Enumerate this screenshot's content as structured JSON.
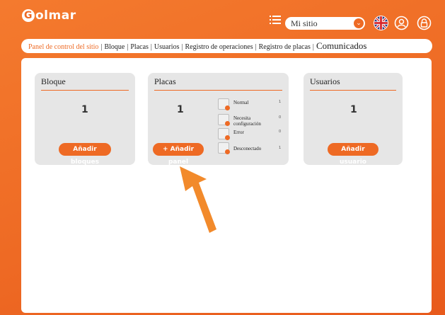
{
  "app": {
    "logo_letter": "G",
    "logo_rest": "olmar"
  },
  "header": {
    "site_select_value": "Mi sitio"
  },
  "nav": {
    "items": [
      {
        "label": "Panel de control del sitio",
        "active": true
      },
      {
        "label": "Bloque"
      },
      {
        "label": "Placas"
      },
      {
        "label": "Usuarios"
      },
      {
        "label": "Registro de operaciones"
      },
      {
        "label": "Registro de placas"
      },
      {
        "label": "Comunicados"
      }
    ]
  },
  "cards": {
    "bloque": {
      "title": "Bloque",
      "value": "1",
      "button": "Añadir bloques"
    },
    "placas": {
      "title": "Placas",
      "value": "1",
      "button": "+ Añadir panel",
      "statuses": [
        {
          "label": "Normal",
          "count": "1"
        },
        {
          "label": "Necesita configuración",
          "count": "0"
        },
        {
          "label": "Error",
          "count": "0"
        },
        {
          "label": "Desconectado",
          "count": "1"
        }
      ]
    },
    "usuarios": {
      "title": "Usuarios",
      "value": "1",
      "button": "Añadir usuario"
    }
  },
  "colors": {
    "accent": "#ee6a24",
    "card_bg": "#e6e6e6"
  }
}
